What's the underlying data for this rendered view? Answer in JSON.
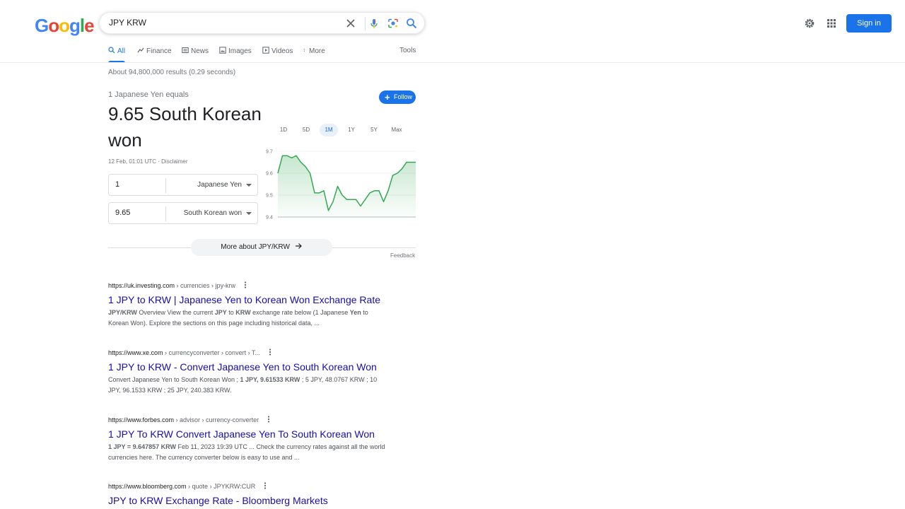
{
  "header": {
    "logo_letters": [
      {
        "ch": "G",
        "color": "#4285f4"
      },
      {
        "ch": "o",
        "color": "#ea4335"
      },
      {
        "ch": "o",
        "color": "#fbbc05"
      },
      {
        "ch": "g",
        "color": "#4285f4"
      },
      {
        "ch": "l",
        "color": "#34a853"
      },
      {
        "ch": "e",
        "color": "#ea4335"
      }
    ],
    "search_query": "JPY KRW",
    "sign_in_label": "Sign in",
    "accent_color": "#1a73e8"
  },
  "tabs": [
    {
      "label": "All",
      "icon": "search-icon",
      "active": true
    },
    {
      "label": "Finance",
      "icon": "finance-icon"
    },
    {
      "label": "News",
      "icon": "news-icon"
    },
    {
      "label": "Images",
      "icon": "image-icon"
    },
    {
      "label": "Videos",
      "icon": "video-icon"
    },
    {
      "label": "More",
      "icon": "more-vert-icon"
    }
  ],
  "tools_label": "Tools",
  "result_stats": "About 94,800,000 results (0.29 seconds)",
  "converter": {
    "equals_label": "1 Japanese Yen equals",
    "big_value": "9.65 South Korean won",
    "updated": "12 Feb, 01:01 UTC · Disclaimer",
    "follow_label": "Follow",
    "from_amount": "1",
    "from_currency": "Japanese Yen",
    "to_amount": "9.65",
    "to_currency": "South Korean won",
    "ranges": [
      "1D",
      "5D",
      "1M",
      "1Y",
      "5Y",
      "Max"
    ],
    "active_range": "1M",
    "more_label": "More about JPY/KRW",
    "feedback_label": "Feedback"
  },
  "chart_data": {
    "type": "area",
    "yticks": [
      "9.7",
      "9.6",
      "9.5",
      "9.4"
    ],
    "ylim": [
      9.4,
      9.7
    ],
    "values": [
      9.6,
      9.68,
      9.68,
      9.67,
      9.68,
      9.65,
      9.63,
      9.6,
      9.51,
      9.51,
      9.52,
      9.43,
      9.47,
      9.54,
      9.5,
      9.48,
      9.48,
      9.48,
      9.45,
      9.48,
      9.51,
      9.52,
      9.52,
      9.47,
      9.52,
      9.59,
      9.6,
      9.62,
      9.65,
      9.65,
      9.65
    ],
    "color": "#34a853",
    "grid": true
  },
  "results": [
    {
      "domain": "https://uk.investing.com",
      "crumbs": " › currencies › jpy-krw",
      "title": "1 JPY to KRW | Japanese Yen to Korean Won Exchange Rate",
      "snippet_html": "<b>JPY/KRW</b> Overview View the current <b>JPY</b> to <b>KRW</b> exchange rate below (1 Japanese <b>Yen</b> to Korean Won). Explore the sections on this page including historical data, ..."
    },
    {
      "domain": "https://www.xe.com",
      "crumbs": " › currencyconverter › convert › T...",
      "title": "1 JPY to KRW - Convert Japanese Yen to South Korean Won",
      "snippet_html": "Convert Japanese Yen to South Korean Won ; <b>1 JPY, 9.61533 KRW</b> ; 5 JPY, 48.0767 KRW ; 10 JPY, 96.1533 KRW ; 25 JPY, 240.383 KRW."
    },
    {
      "domain": "https://www.forbes.com",
      "crumbs": " › advisor › currency-converter",
      "title": "1 JPY To KRW Convert Japanese Yen To South Korean Won",
      "snippet_html": "<b>1 JPY = 9.647857 KRW</b> Feb 11, 2023 19:39 UTC ... Check the currency rates against all the world currencies here. The currency converter below is easy to use and ..."
    },
    {
      "domain": "https://www.bloomberg.com",
      "crumbs": " › quote › JPYKRW:CUR",
      "title": "JPY to KRW Exchange Rate - Bloomberg Markets",
      "snippet_html": ""
    }
  ]
}
